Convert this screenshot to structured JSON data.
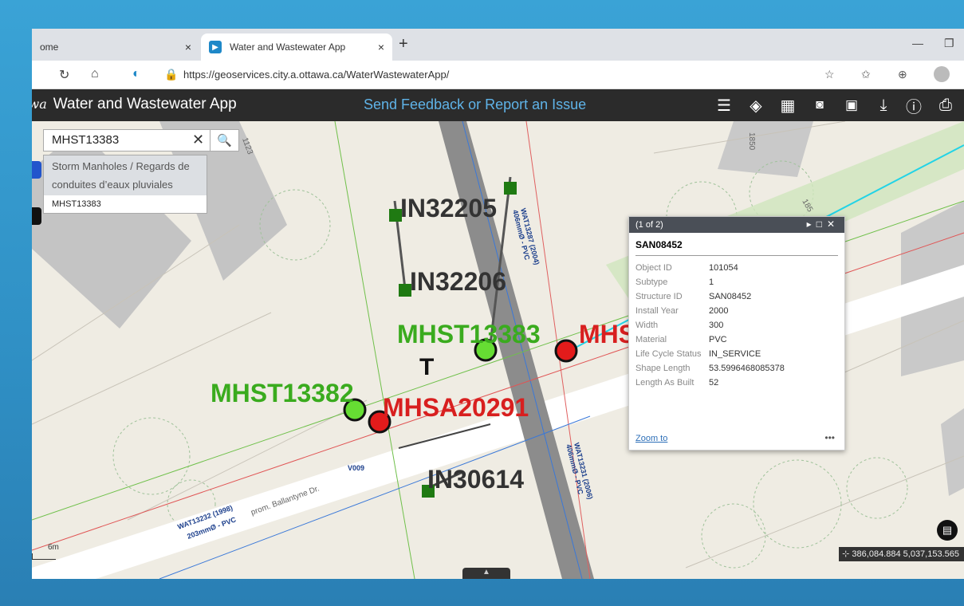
{
  "browser": {
    "tabs": [
      {
        "label": "ome",
        "active": false
      },
      {
        "label": "Water and Wastewater App",
        "active": true
      }
    ],
    "close_glyph": "×",
    "new_tab_glyph": "+",
    "url": "https://geoservices.city.a.ottawa.ca/WaterWastewaterApp/"
  },
  "app": {
    "logo_text": "awa",
    "title": "Water and Wastewater App",
    "feedback_link": "Send Feedback or Report an Issue",
    "toolbar_icons": [
      "list-icon",
      "layers-icon",
      "grid-icon",
      "camera-icon",
      "clipboard-icon",
      "download-icon",
      "info-icon",
      "print-icon"
    ]
  },
  "search": {
    "value": "MHST13383",
    "clear_glyph": "✕",
    "suggest_group": "Storm Manholes / Regards de conduites d’eaux pluviales",
    "suggest_item": "MHST13383"
  },
  "map_labels": {
    "in32205": "IN32205",
    "in32206": "IN32206",
    "mhst13383": "MHST13383",
    "mhs": "MHS",
    "mhst13382": "MHST13382",
    "mhsa20291": "MHSA20291",
    "in30614": "IN30614",
    "t_marker": "T",
    "wat13287": "WAT13287 (2004)",
    "wat13287b": "406mmØ - PVC",
    "wat13231": "WAT13231 (2006)",
    "wat13231b": "406mmØ - PVC",
    "wat13232": "WAT13232 (1998)",
    "wat13232b": "203mmØ - PVC",
    "street": "prom. Ballantyne Dr.",
    "v009": "V009",
    "addr1123": "1123",
    "addr1850": "1850",
    "addr185": "185",
    "scale": "6m"
  },
  "popup": {
    "header": "(1 of 2)",
    "title": "SAN08452",
    "rows": [
      {
        "k": "Object ID",
        "v": "101054"
      },
      {
        "k": "Subtype",
        "v": "1"
      },
      {
        "k": "Structure ID",
        "v": "SAN08452"
      },
      {
        "k": "Install Year",
        "v": "2000"
      },
      {
        "k": "Width",
        "v": "300"
      },
      {
        "k": "Material",
        "v": "PVC"
      },
      {
        "k": "Life Cycle Status",
        "v": "IN_SERVICE"
      },
      {
        "k": "Shape Length",
        "v": "53.5996468085378"
      },
      {
        "k": "Length As Built",
        "v": "52"
      }
    ],
    "zoom_label": "Zoom to",
    "more_label": "•••"
  },
  "coords": "386,084.884 5,037,153.565",
  "colors": {
    "storm_green": "#3aab1e",
    "sanitary_red": "#d81f1f",
    "inlet_green": "#1f7a12",
    "feedback_blue": "#5fb3e8"
  }
}
